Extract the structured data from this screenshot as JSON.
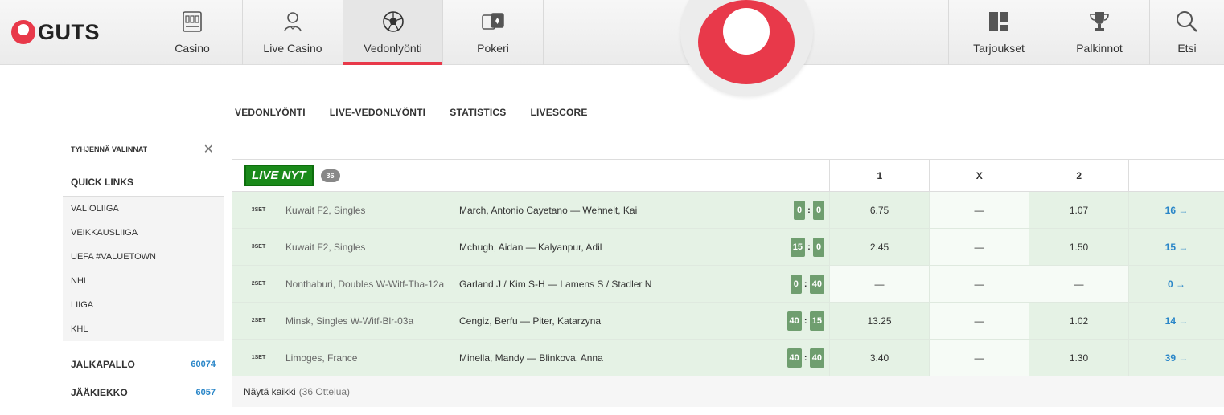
{
  "brand": {
    "name": "GUTS",
    "accent": "#e8394a"
  },
  "nav": {
    "left": [
      {
        "label": "Casino",
        "icon": "slot-machine-icon"
      },
      {
        "label": "Live Casino",
        "icon": "dealer-icon"
      },
      {
        "label": "Vedonlyönti",
        "icon": "football-icon"
      },
      {
        "label": "Pokeri",
        "icon": "cards-icon"
      }
    ],
    "right": [
      {
        "label": "Tarjoukset",
        "icon": "layout-icon"
      },
      {
        "label": "Palkinnot",
        "icon": "trophy-icon"
      },
      {
        "label": "Etsi",
        "icon": "search-icon"
      }
    ]
  },
  "subnav": [
    "VEDONLYÖNTI",
    "LIVE-VEDONLYÖNTI",
    "STATISTICS",
    "LIVESCORE"
  ],
  "sidebar": {
    "clear": "TYHJENNÄ VALINNAT",
    "quick_links_title": "QUICK LINKS",
    "quick_links": [
      "VALIOLIIGA",
      "VEIKKAUSLIIGA",
      "UEFA #VALUETOWN",
      "NHL",
      "LIIGA",
      "KHL"
    ],
    "sports": [
      {
        "name": "JALKAPALLO",
        "count": "60074"
      },
      {
        "name": "JÄÄKIEKKO",
        "count": "6057"
      }
    ]
  },
  "live": {
    "badge": "LIVE NYT",
    "count": "36",
    "cols": [
      "1",
      "X",
      "2"
    ],
    "rows": [
      {
        "set": "3SET",
        "league": "Kuwait F2, Singles",
        "teams": "March, Antonio Cayetano — Wehnelt, Kai",
        "s1": "0",
        "s2": "0",
        "o1": "6.75",
        "ox": "—",
        "o2": "1.07",
        "more": "16 →"
      },
      {
        "set": "3SET",
        "league": "Kuwait F2, Singles",
        "teams": "Mchugh, Aidan — Kalyanpur, Adil",
        "s1": "15",
        "s2": "0",
        "o1": "2.45",
        "ox": "—",
        "o2": "1.50",
        "more": "15 →"
      },
      {
        "set": "2SET",
        "league": "Nonthaburi, Doubles W-Witf-Tha-12a",
        "teams": "Garland J / Kim S-H — Lamens S / Stadler N",
        "s1": "0",
        "s2": "40",
        "o1": "—",
        "ox": "—",
        "o2": "—",
        "more": "0 →"
      },
      {
        "set": "2SET",
        "league": "Minsk, Singles W-Witf-Blr-03a",
        "teams": "Cengiz, Berfu — Piter, Katarzyna",
        "s1": "40",
        "s2": "15",
        "o1": "13.25",
        "ox": "—",
        "o2": "1.02",
        "more": "14 →"
      },
      {
        "set": "1SET",
        "league": "Limoges, France",
        "teams": "Minella, Mandy — Blinkova, Anna",
        "s1": "40",
        "s2": "40",
        "o1": "3.40",
        "ox": "—",
        "o2": "1.30",
        "more": "39 →"
      }
    ],
    "show_all": "Näytä kaikki",
    "show_all_sub": "(36 Ottelua)"
  }
}
